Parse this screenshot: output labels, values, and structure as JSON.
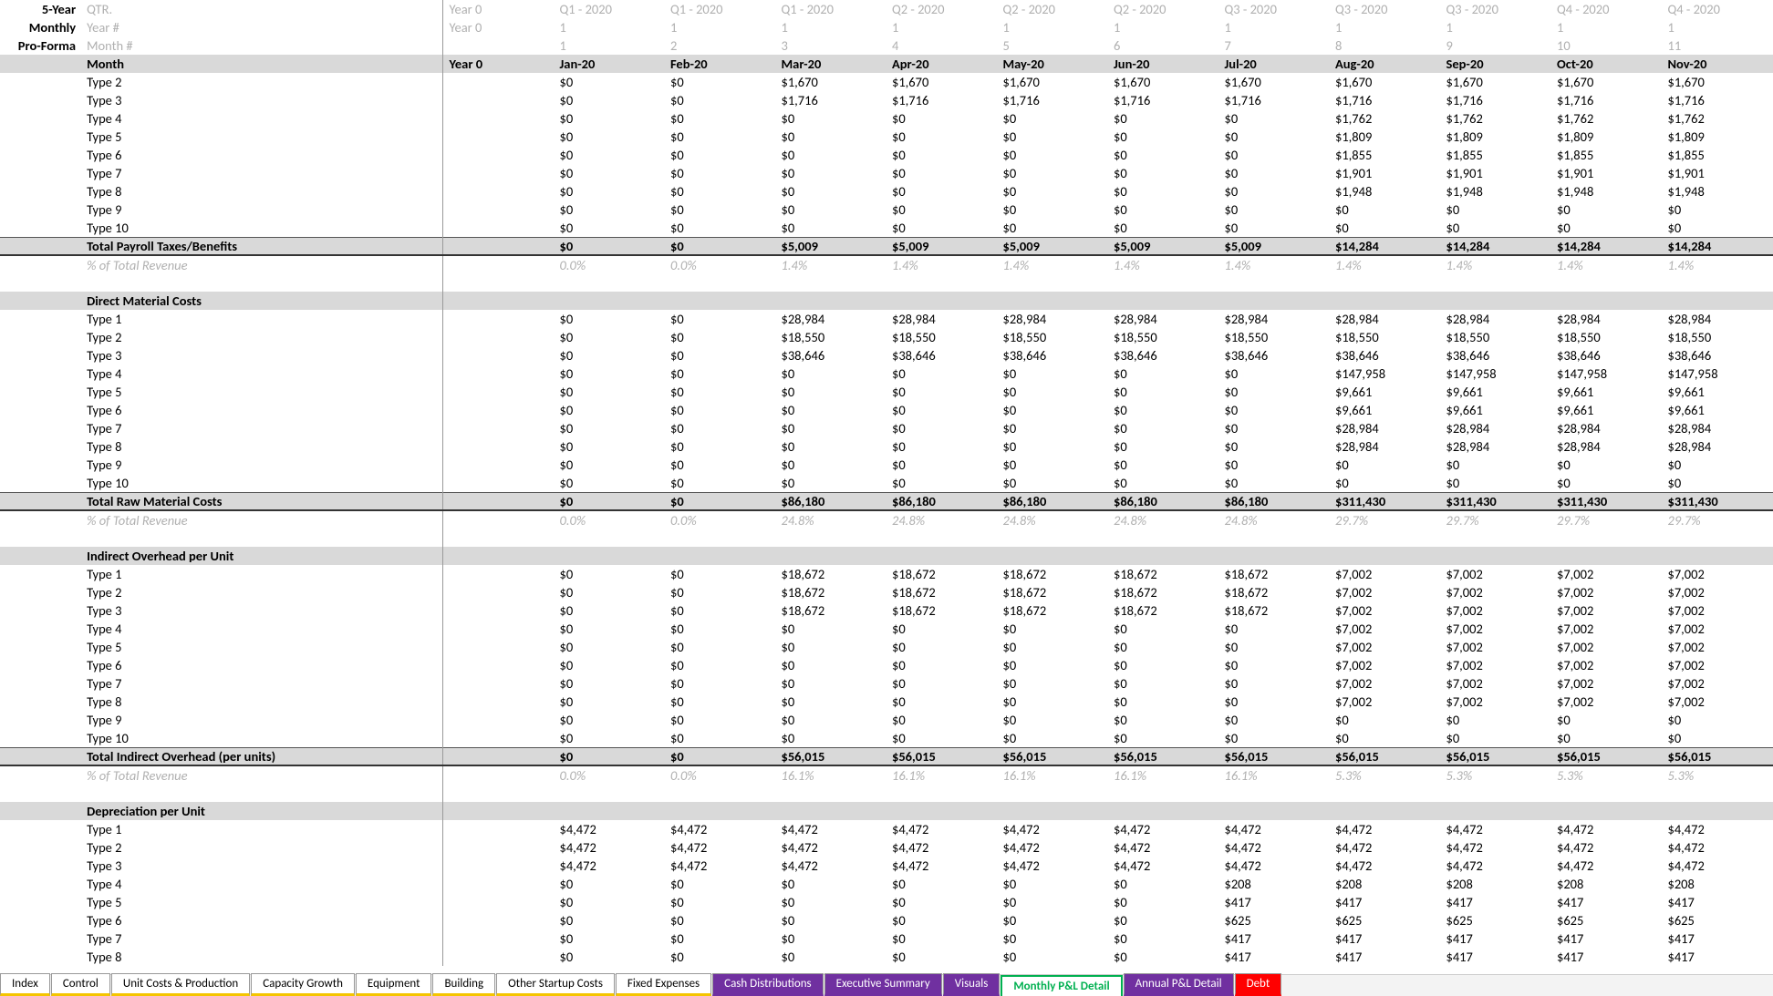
{
  "header": {
    "labels": [
      "5-Year",
      "Monthly",
      "Pro-Forma"
    ],
    "meta_labels": [
      "QTR.",
      "Year #",
      "Month #"
    ],
    "year0": "Year 0",
    "qtr": [
      "Q1 - 2020",
      "Q1 - 2020",
      "Q1 - 2020",
      "Q2 - 2020",
      "Q2 - 2020",
      "Q2 - 2020",
      "Q3 - 2020",
      "Q3 - 2020",
      "Q3 - 2020",
      "Q4 - 2020",
      "Q4 - 2020"
    ],
    "year_row": [
      "Year 0",
      "1",
      "1",
      "1",
      "1",
      "1",
      "1",
      "1",
      "1",
      "1",
      "1",
      "1"
    ],
    "month_row": [
      "",
      "1",
      "2",
      "3",
      "4",
      "5",
      "6",
      "7",
      "8",
      "9",
      "10",
      "11"
    ],
    "month_hdr_label": "Month",
    "year0_hdr": "Year 0",
    "months": [
      "Jan-20",
      "Feb-20",
      "Mar-20",
      "Apr-20",
      "May-20",
      "Jun-20",
      "Jul-20",
      "Aug-20",
      "Sep-20",
      "Oct-20",
      "Nov-20"
    ]
  },
  "pct_label": "% of Total Revenue",
  "sections": [
    {
      "title": null,
      "rows": [
        {
          "label": "Type 2",
          "vals": [
            "$0",
            "$0",
            "$1,670",
            "$1,670",
            "$1,670",
            "$1,670",
            "$1,670",
            "$1,670",
            "$1,670",
            "$1,670",
            "$1,670"
          ]
        },
        {
          "label": "Type 3",
          "vals": [
            "$0",
            "$0",
            "$1,716",
            "$1,716",
            "$1,716",
            "$1,716",
            "$1,716",
            "$1,716",
            "$1,716",
            "$1,716",
            "$1,716"
          ]
        },
        {
          "label": "Type 4",
          "vals": [
            "$0",
            "$0",
            "$0",
            "$0",
            "$0",
            "$0",
            "$0",
            "$1,762",
            "$1,762",
            "$1,762",
            "$1,762"
          ]
        },
        {
          "label": "Type 5",
          "vals": [
            "$0",
            "$0",
            "$0",
            "$0",
            "$0",
            "$0",
            "$0",
            "$1,809",
            "$1,809",
            "$1,809",
            "$1,809"
          ]
        },
        {
          "label": "Type 6",
          "vals": [
            "$0",
            "$0",
            "$0",
            "$0",
            "$0",
            "$0",
            "$0",
            "$1,855",
            "$1,855",
            "$1,855",
            "$1,855"
          ]
        },
        {
          "label": "Type 7",
          "vals": [
            "$0",
            "$0",
            "$0",
            "$0",
            "$0",
            "$0",
            "$0",
            "$1,901",
            "$1,901",
            "$1,901",
            "$1,901"
          ]
        },
        {
          "label": "Type 8",
          "vals": [
            "$0",
            "$0",
            "$0",
            "$0",
            "$0",
            "$0",
            "$0",
            "$1,948",
            "$1,948",
            "$1,948",
            "$1,948"
          ]
        },
        {
          "label": "Type 9",
          "vals": [
            "$0",
            "$0",
            "$0",
            "$0",
            "$0",
            "$0",
            "$0",
            "$0",
            "$0",
            "$0",
            "$0"
          ]
        },
        {
          "label": "Type 10",
          "vals": [
            "$0",
            "$0",
            "$0",
            "$0",
            "$0",
            "$0",
            "$0",
            "$0",
            "$0",
            "$0",
            "$0"
          ]
        }
      ],
      "total": {
        "label": "Total Payroll Taxes/Benefits",
        "vals": [
          "$0",
          "$0",
          "$5,009",
          "$5,009",
          "$5,009",
          "$5,009",
          "$5,009",
          "$14,284",
          "$14,284",
          "$14,284",
          "$14,284"
        ]
      },
      "pct": [
        "0.0%",
        "0.0%",
        "1.4%",
        "1.4%",
        "1.4%",
        "1.4%",
        "1.4%",
        "1.4%",
        "1.4%",
        "1.4%",
        "1.4%"
      ]
    },
    {
      "title": "Direct Material Costs",
      "rows": [
        {
          "label": "Type 1",
          "vals": [
            "$0",
            "$0",
            "$28,984",
            "$28,984",
            "$28,984",
            "$28,984",
            "$28,984",
            "$28,984",
            "$28,984",
            "$28,984",
            "$28,984"
          ]
        },
        {
          "label": "Type 2",
          "vals": [
            "$0",
            "$0",
            "$18,550",
            "$18,550",
            "$18,550",
            "$18,550",
            "$18,550",
            "$18,550",
            "$18,550",
            "$18,550",
            "$18,550"
          ]
        },
        {
          "label": "Type 3",
          "vals": [
            "$0",
            "$0",
            "$38,646",
            "$38,646",
            "$38,646",
            "$38,646",
            "$38,646",
            "$38,646",
            "$38,646",
            "$38,646",
            "$38,646"
          ]
        },
        {
          "label": "Type 4",
          "vals": [
            "$0",
            "$0",
            "$0",
            "$0",
            "$0",
            "$0",
            "$0",
            "$147,958",
            "$147,958",
            "$147,958",
            "$147,958"
          ]
        },
        {
          "label": "Type 5",
          "vals": [
            "$0",
            "$0",
            "$0",
            "$0",
            "$0",
            "$0",
            "$0",
            "$9,661",
            "$9,661",
            "$9,661",
            "$9,661"
          ]
        },
        {
          "label": "Type 6",
          "vals": [
            "$0",
            "$0",
            "$0",
            "$0",
            "$0",
            "$0",
            "$0",
            "$9,661",
            "$9,661",
            "$9,661",
            "$9,661"
          ]
        },
        {
          "label": "Type 7",
          "vals": [
            "$0",
            "$0",
            "$0",
            "$0",
            "$0",
            "$0",
            "$0",
            "$28,984",
            "$28,984",
            "$28,984",
            "$28,984"
          ]
        },
        {
          "label": "Type 8",
          "vals": [
            "$0",
            "$0",
            "$0",
            "$0",
            "$0",
            "$0",
            "$0",
            "$28,984",
            "$28,984",
            "$28,984",
            "$28,984"
          ]
        },
        {
          "label": "Type 9",
          "vals": [
            "$0",
            "$0",
            "$0",
            "$0",
            "$0",
            "$0",
            "$0",
            "$0",
            "$0",
            "$0",
            "$0"
          ]
        },
        {
          "label": "Type 10",
          "vals": [
            "$0",
            "$0",
            "$0",
            "$0",
            "$0",
            "$0",
            "$0",
            "$0",
            "$0",
            "$0",
            "$0"
          ]
        }
      ],
      "total": {
        "label": "Total Raw Material Costs",
        "vals": [
          "$0",
          "$0",
          "$86,180",
          "$86,180",
          "$86,180",
          "$86,180",
          "$86,180",
          "$311,430",
          "$311,430",
          "$311,430",
          "$311,430"
        ]
      },
      "pct": [
        "0.0%",
        "0.0%",
        "24.8%",
        "24.8%",
        "24.8%",
        "24.8%",
        "24.8%",
        "29.7%",
        "29.7%",
        "29.7%",
        "29.7%"
      ]
    },
    {
      "title": "Indirect Overhead per Unit",
      "rows": [
        {
          "label": "Type 1",
          "vals": [
            "$0",
            "$0",
            "$18,672",
            "$18,672",
            "$18,672",
            "$18,672",
            "$18,672",
            "$7,002",
            "$7,002",
            "$7,002",
            "$7,002"
          ]
        },
        {
          "label": "Type 2",
          "vals": [
            "$0",
            "$0",
            "$18,672",
            "$18,672",
            "$18,672",
            "$18,672",
            "$18,672",
            "$7,002",
            "$7,002",
            "$7,002",
            "$7,002"
          ]
        },
        {
          "label": "Type 3",
          "vals": [
            "$0",
            "$0",
            "$18,672",
            "$18,672",
            "$18,672",
            "$18,672",
            "$18,672",
            "$7,002",
            "$7,002",
            "$7,002",
            "$7,002"
          ]
        },
        {
          "label": "Type 4",
          "vals": [
            "$0",
            "$0",
            "$0",
            "$0",
            "$0",
            "$0",
            "$0",
            "$7,002",
            "$7,002",
            "$7,002",
            "$7,002"
          ]
        },
        {
          "label": "Type 5",
          "vals": [
            "$0",
            "$0",
            "$0",
            "$0",
            "$0",
            "$0",
            "$0",
            "$7,002",
            "$7,002",
            "$7,002",
            "$7,002"
          ]
        },
        {
          "label": "Type 6",
          "vals": [
            "$0",
            "$0",
            "$0",
            "$0",
            "$0",
            "$0",
            "$0",
            "$7,002",
            "$7,002",
            "$7,002",
            "$7,002"
          ]
        },
        {
          "label": "Type 7",
          "vals": [
            "$0",
            "$0",
            "$0",
            "$0",
            "$0",
            "$0",
            "$0",
            "$7,002",
            "$7,002",
            "$7,002",
            "$7,002"
          ]
        },
        {
          "label": "Type 8",
          "vals": [
            "$0",
            "$0",
            "$0",
            "$0",
            "$0",
            "$0",
            "$0",
            "$7,002",
            "$7,002",
            "$7,002",
            "$7,002"
          ]
        },
        {
          "label": "Type 9",
          "vals": [
            "$0",
            "$0",
            "$0",
            "$0",
            "$0",
            "$0",
            "$0",
            "$0",
            "$0",
            "$0",
            "$0"
          ]
        },
        {
          "label": "Type 10",
          "vals": [
            "$0",
            "$0",
            "$0",
            "$0",
            "$0",
            "$0",
            "$0",
            "$0",
            "$0",
            "$0",
            "$0"
          ]
        }
      ],
      "total": {
        "label": "Total Indirect Overhead (per units)",
        "vals": [
          "$0",
          "$0",
          "$56,015",
          "$56,015",
          "$56,015",
          "$56,015",
          "$56,015",
          "$56,015",
          "$56,015",
          "$56,015",
          "$56,015"
        ]
      },
      "pct": [
        "0.0%",
        "0.0%",
        "16.1%",
        "16.1%",
        "16.1%",
        "16.1%",
        "16.1%",
        "5.3%",
        "5.3%",
        "5.3%",
        "5.3%"
      ]
    },
    {
      "title": "Depreciation per Unit",
      "rows": [
        {
          "label": "Type 1",
          "vals": [
            "$4,472",
            "$4,472",
            "$4,472",
            "$4,472",
            "$4,472",
            "$4,472",
            "$4,472",
            "$4,472",
            "$4,472",
            "$4,472",
            "$4,472"
          ]
        },
        {
          "label": "Type 2",
          "vals": [
            "$4,472",
            "$4,472",
            "$4,472",
            "$4,472",
            "$4,472",
            "$4,472",
            "$4,472",
            "$4,472",
            "$4,472",
            "$4,472",
            "$4,472"
          ]
        },
        {
          "label": "Type 3",
          "vals": [
            "$4,472",
            "$4,472",
            "$4,472",
            "$4,472",
            "$4,472",
            "$4,472",
            "$4,472",
            "$4,472",
            "$4,472",
            "$4,472",
            "$4,472"
          ]
        },
        {
          "label": "Type 4",
          "vals": [
            "$0",
            "$0",
            "$0",
            "$0",
            "$0",
            "$0",
            "$208",
            "$208",
            "$208",
            "$208",
            "$208"
          ]
        },
        {
          "label": "Type 5",
          "vals": [
            "$0",
            "$0",
            "$0",
            "$0",
            "$0",
            "$0",
            "$417",
            "$417",
            "$417",
            "$417",
            "$417"
          ]
        },
        {
          "label": "Type 6",
          "vals": [
            "$0",
            "$0",
            "$0",
            "$0",
            "$0",
            "$0",
            "$625",
            "$625",
            "$625",
            "$625",
            "$625"
          ]
        },
        {
          "label": "Type 7",
          "vals": [
            "$0",
            "$0",
            "$0",
            "$0",
            "$0",
            "$0",
            "$417",
            "$417",
            "$417",
            "$417",
            "$417"
          ]
        },
        {
          "label": "Type 8",
          "vals": [
            "$0",
            "$0",
            "$0",
            "$0",
            "$0",
            "$0",
            "$417",
            "$417",
            "$417",
            "$417",
            "$417"
          ]
        }
      ]
    }
  ],
  "tabs": [
    {
      "label": "Index",
      "cls": "yellow"
    },
    {
      "label": "Control",
      "cls": "yellow"
    },
    {
      "label": "Unit Costs & Production",
      "cls": "yellow"
    },
    {
      "label": "Capacity Growth",
      "cls": "yellow"
    },
    {
      "label": "Equipment",
      "cls": "yellow"
    },
    {
      "label": "Building",
      "cls": "yellow"
    },
    {
      "label": "Other Startup Costs",
      "cls": "yellow"
    },
    {
      "label": "Fixed Expenses",
      "cls": "yellow"
    },
    {
      "label": "Cash Distributions",
      "cls": "purple"
    },
    {
      "label": "Executive Summary",
      "cls": "purple"
    },
    {
      "label": "Visuals",
      "cls": "purple"
    },
    {
      "label": "Monthly P&L Detail",
      "cls": "active"
    },
    {
      "label": "Annual P&L Detail",
      "cls": "purple"
    },
    {
      "label": "Debt",
      "cls": "red"
    }
  ]
}
